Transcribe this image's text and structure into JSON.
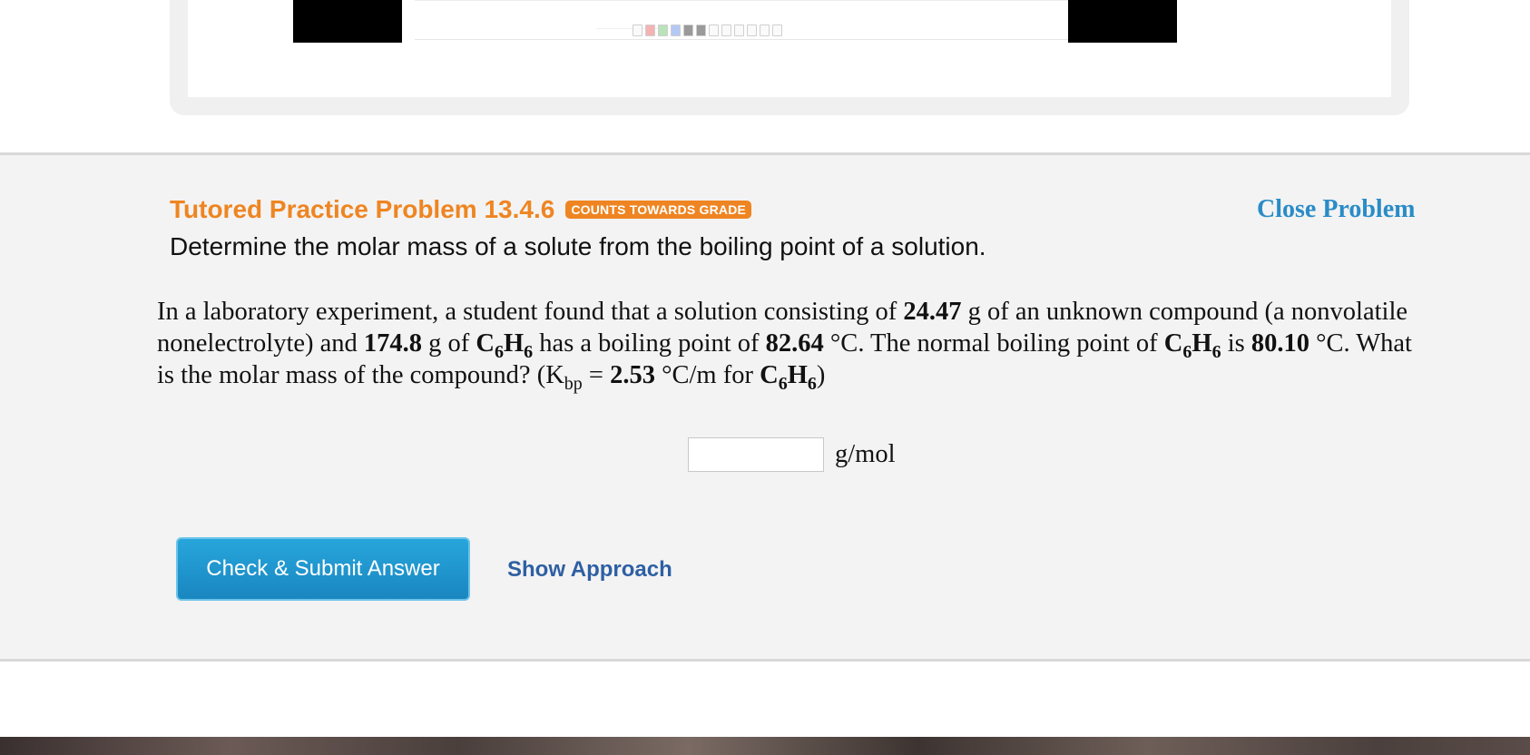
{
  "problem": {
    "title": "Tutored Practice Problem 13.4.6",
    "badge": "COUNTS TOWARDS GRADE",
    "close_label": "Close Problem",
    "subtitle": "Determine the molar mass of a solute from the boiling point of a solution.",
    "text": {
      "p1": "In a laboratory experiment, a student found that a solution consisting of ",
      "mass_solute": "24.47",
      "p2": " g of an unknown compound (a nonvolatile nonelectrolyte) and ",
      "mass_solvent": "174.8",
      "p3": " g of ",
      "solvent_C": "C",
      "solvent_sub1": "6",
      "solvent_H": "H",
      "solvent_sub2": "6",
      "p4": " has a boiling point of ",
      "bp_solution": "82.64",
      "p5": " °C. The normal boiling point of ",
      "p6": " is ",
      "bp_normal": "80.10",
      "p7": " °C. What is the molar mass of the compound? (K",
      "k_sub": "bp",
      "p8": " = ",
      "kbp": "2.53",
      "p9": " °C/m for ",
      "p10": ")"
    },
    "answer": {
      "value": "",
      "placeholder": "",
      "unit": "g/mol"
    },
    "submit_label": "Check & Submit Answer",
    "approach_label": "Show Approach"
  },
  "colors": {
    "title": "#ee8522",
    "link": "#2a8cc7",
    "button": "#1a86c0",
    "panel": "#f3f3f3"
  }
}
